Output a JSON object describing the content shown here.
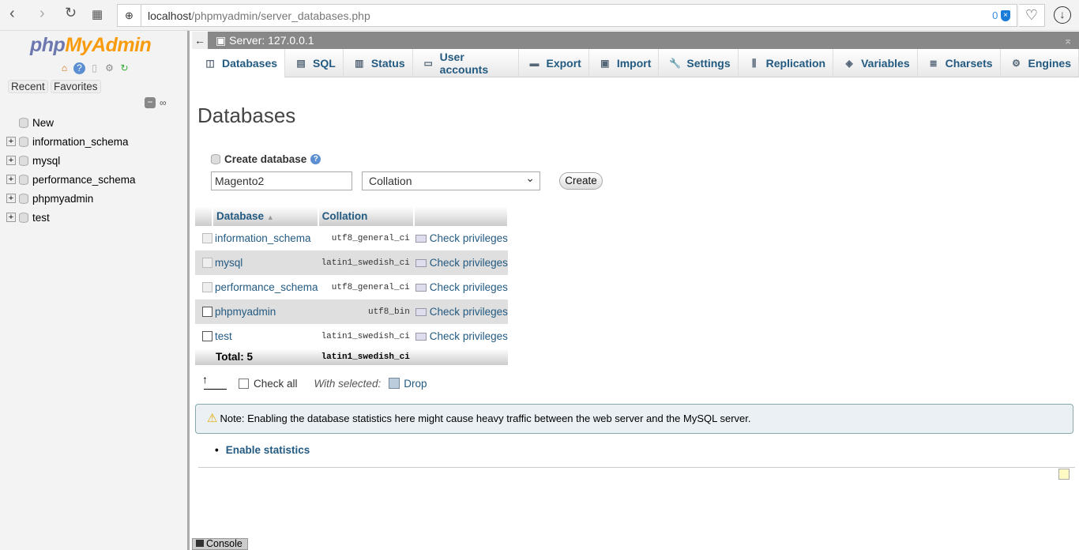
{
  "browser": {
    "url_host": "localhost",
    "url_path": "/phpmyadmin/server_databases.php",
    "tracker_count": "0"
  },
  "sidebar": {
    "logo_php": "php",
    "logo_myadmin": "MyAdmin",
    "recent": "Recent",
    "favorites": "Favorites",
    "tree": [
      {
        "label": "New"
      },
      {
        "label": "information_schema"
      },
      {
        "label": "mysql"
      },
      {
        "label": "performance_schema"
      },
      {
        "label": "phpmyadmin"
      },
      {
        "label": "test"
      }
    ]
  },
  "topbar": {
    "server": "Server: 127.0.0.1"
  },
  "tabs": [
    {
      "label": "Databases",
      "icon": "database-icon"
    },
    {
      "label": "SQL",
      "icon": "sql-icon"
    },
    {
      "label": "Status",
      "icon": "status-icon"
    },
    {
      "label": "User accounts",
      "icon": "users-icon"
    },
    {
      "label": "Export",
      "icon": "export-icon"
    },
    {
      "label": "Import",
      "icon": "import-icon"
    },
    {
      "label": "Settings",
      "icon": "wrench-icon"
    },
    {
      "label": "Replication",
      "icon": "replication-icon"
    },
    {
      "label": "Variables",
      "icon": "variables-icon"
    },
    {
      "label": "Charsets",
      "icon": "charsets-icon"
    },
    {
      "label": "Engines",
      "icon": "engines-icon"
    }
  ],
  "main": {
    "title": "Databases",
    "create_label": "Create database",
    "db_name_value": "Magento2",
    "collation_value": "Collation",
    "create_button": "Create",
    "table": {
      "headers": [
        "Database",
        "Collation"
      ],
      "rows": [
        {
          "name": "information_schema",
          "collation": "utf8_general_ci",
          "action": "Check privileges",
          "enabled": false
        },
        {
          "name": "mysql",
          "collation": "latin1_swedish_ci",
          "action": "Check privileges",
          "enabled": false
        },
        {
          "name": "performance_schema",
          "collation": "utf8_general_ci",
          "action": "Check privileges",
          "enabled": false
        },
        {
          "name": "phpmyadmin",
          "collation": "utf8_bin",
          "action": "Check privileges",
          "enabled": true
        },
        {
          "name": "test",
          "collation": "latin1_swedish_ci",
          "action": "Check privileges",
          "enabled": true
        }
      ],
      "total_label": "Total: 5",
      "total_collation": "latin1_swedish_ci"
    },
    "check_all": "Check all",
    "with_selected": "With selected:",
    "drop": "Drop",
    "note": "Note: Enabling the database statistics here might cause heavy traffic between the web server and the MySQL server.",
    "enable_stats": "Enable statistics"
  },
  "console": "Console"
}
